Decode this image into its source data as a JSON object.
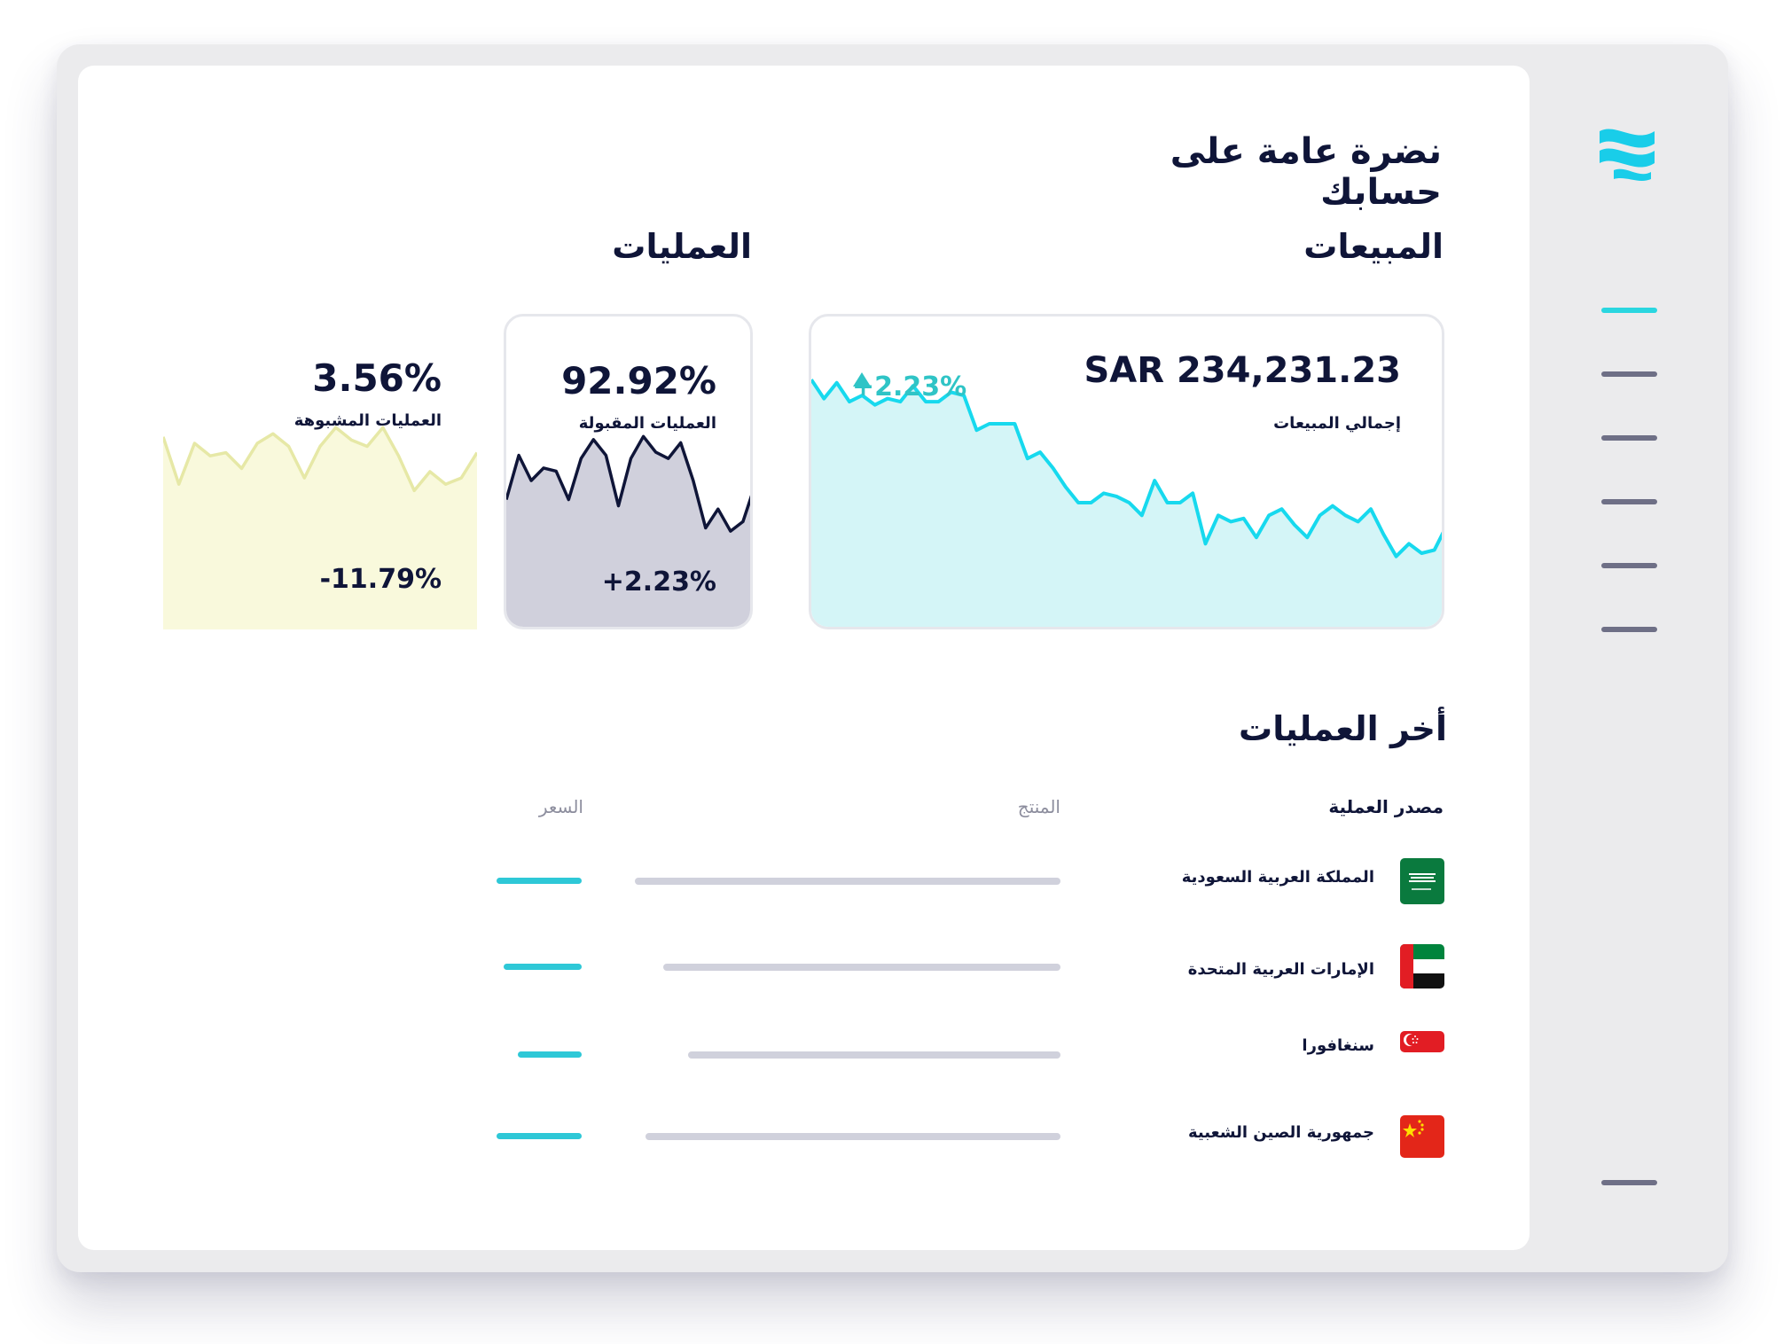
{
  "page_title": "نضرة عامة على حسابك",
  "sales": {
    "section_title": "المبيعات",
    "amount": "SAR 234,231.23",
    "label": "إجمالي المبيعات",
    "change": "+2.23%",
    "change_icon": "triangle-up-icon",
    "spark": [
      0.8,
      0.74,
      0.79,
      0.73,
      0.75,
      0.72,
      0.74,
      0.73,
      0.78,
      0.73,
      0.73,
      0.76,
      0.75,
      0.64,
      0.66,
      0.66,
      0.66,
      0.55,
      0.57,
      0.52,
      0.46,
      0.41,
      0.41,
      0.44,
      0.43,
      0.41,
      0.37,
      0.48,
      0.41,
      0.41,
      0.44,
      0.28,
      0.37,
      0.35,
      0.36,
      0.3,
      0.37,
      0.39,
      0.34,
      0.3,
      0.37,
      0.4,
      0.37,
      0.35,
      0.39,
      0.31,
      0.24,
      0.28,
      0.25,
      0.26,
      0.34
    ]
  },
  "operations": {
    "section_title": "العمليات",
    "accepted": {
      "value": "92.92%",
      "label": "العمليات المقبولة",
      "change": "+2.23%",
      "spark": [
        0.42,
        0.56,
        0.48,
        0.52,
        0.51,
        0.42,
        0.55,
        0.61,
        0.56,
        0.4,
        0.55,
        0.62,
        0.57,
        0.55,
        0.6,
        0.48,
        0.33,
        0.39,
        0.32,
        0.35,
        0.47
      ]
    },
    "suspicious": {
      "value": "3.56%",
      "label": "العمليات المشبوهة",
      "change": "-11.79%",
      "spark": [
        0.61,
        0.46,
        0.59,
        0.55,
        0.56,
        0.51,
        0.59,
        0.62,
        0.58,
        0.48,
        0.58,
        0.64,
        0.6,
        0.58,
        0.64,
        0.55,
        0.44,
        0.5,
        0.46,
        0.48,
        0.56
      ]
    }
  },
  "latest": {
    "section_title": "أخر العمليات",
    "columns": {
      "source": "مصدر العملية",
      "product": "المنتج",
      "price": "السعر"
    },
    "rows": [
      {
        "country": "المملكة العربية السعودية",
        "flag_icon": "saudi-flag-icon"
      },
      {
        "country": "الإمارات العربية المتحدة",
        "flag_icon": "uae-flag-icon"
      },
      {
        "country": "سنغافورا",
        "flag_icon": "singapore-flag-icon"
      },
      {
        "country": "جمهورية الصين الشعبية",
        "flag_icon": "china-flag-icon"
      }
    ]
  },
  "sidebar": {
    "logo_icon": "logo-icon",
    "menu_items": 6
  },
  "colors": {
    "accent": "#2ad6e0",
    "sales_fill": "#d4f5f7",
    "accepted_fill": "#d0d0dc",
    "suspicious_fill": "#f9f9dc",
    "navy": "#0f1538"
  }
}
